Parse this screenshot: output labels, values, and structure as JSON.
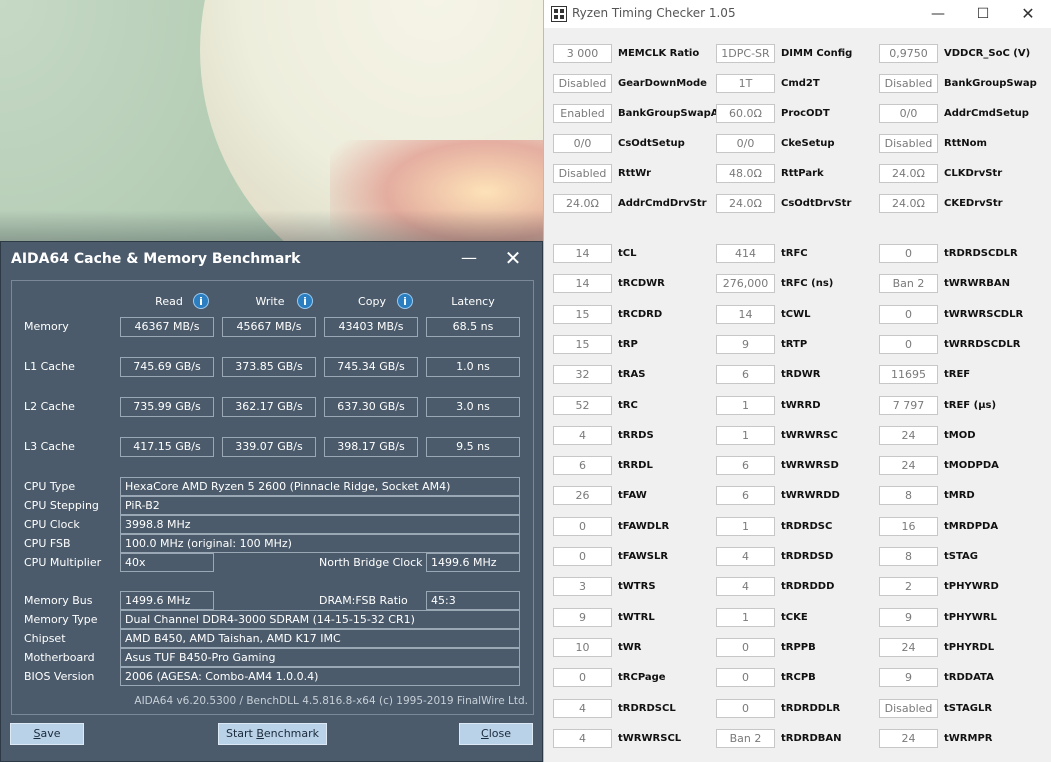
{
  "aida": {
    "title": "AIDA64 Cache & Memory Benchmark",
    "min_glyph": "—",
    "close_glyph": "✕",
    "headers": {
      "read": "Read",
      "write": "Write",
      "copy": "Copy",
      "latency": "Latency"
    },
    "info_glyph": "i",
    "bench_rows": [
      {
        "label": "Memory",
        "read": "46367 MB/s",
        "write": "45667 MB/s",
        "copy": "43403 MB/s",
        "latency": "68.5 ns"
      },
      {
        "label": "L1 Cache",
        "read": "745.69 GB/s",
        "write": "373.85 GB/s",
        "copy": "745.34 GB/s",
        "latency": "1.0 ns"
      },
      {
        "label": "L2 Cache",
        "read": "735.99 GB/s",
        "write": "362.17 GB/s",
        "copy": "637.30 GB/s",
        "latency": "3.0 ns"
      },
      {
        "label": "L3 Cache",
        "read": "417.15 GB/s",
        "write": "339.07 GB/s",
        "copy": "398.17 GB/s",
        "latency": "9.5 ns"
      }
    ],
    "info": {
      "cpu_type_label": "CPU Type",
      "cpu_type": "HexaCore AMD Ryzen 5 2600  (Pinnacle Ridge, Socket AM4)",
      "cpu_stepping_label": "CPU Stepping",
      "cpu_stepping": "PiR-B2",
      "cpu_clock_label": "CPU Clock",
      "cpu_clock": "3998.8 MHz",
      "cpu_fsb_label": "CPU FSB",
      "cpu_fsb": "100.0 MHz  (original: 100 MHz)",
      "cpu_mult_label": "CPU Multiplier",
      "cpu_mult": "40x",
      "nb_clock_label": "North Bridge Clock",
      "nb_clock": "1499.6 MHz",
      "mem_bus_label": "Memory Bus",
      "mem_bus": "1499.6 MHz",
      "dram_ratio_label": "DRAM:FSB Ratio",
      "dram_ratio": "45:3",
      "mem_type_label": "Memory Type",
      "mem_type": "Dual Channel DDR4-3000 SDRAM  (14-15-15-32 CR1)",
      "chipset_label": "Chipset",
      "chipset": "AMD B450, AMD Taishan, AMD K17 IMC",
      "mobo_label": "Motherboard",
      "mobo": "Asus TUF B450-Pro Gaming",
      "bios_label": "BIOS Version",
      "bios": "2006  (AGESA: Combo-AM4 1.0.0.4)"
    },
    "footer": "AIDA64 v6.20.5300 / BenchDLL 4.5.816.8-x64  (c) 1995-2019 FinalWire Ltd.",
    "buttons": {
      "save": "Save",
      "start": "Start Benchmark",
      "close": "Close"
    }
  },
  "rtc": {
    "title": "Ryzen Timing Checker 1.05",
    "min_glyph": "—",
    "max_glyph": "☐",
    "close_glyph": "✕",
    "top_rows": [
      [
        [
          "3 000",
          "MEMCLK Ratio"
        ],
        [
          "1DPC-SR",
          "DIMM Config"
        ],
        [
          "0,9750",
          "VDDCR_SoC (V)"
        ]
      ],
      [
        [
          "Disabled",
          "GearDownMode"
        ],
        [
          "1T",
          "Cmd2T"
        ],
        [
          "Disabled",
          "BankGroupSwap"
        ]
      ],
      [
        [
          "Enabled",
          "BankGroupSwapAlt"
        ],
        [
          "60.0Ω",
          "ProcODT"
        ],
        [
          "0/0",
          "AddrCmdSetup"
        ]
      ],
      [
        [
          "0/0",
          "CsOdtSetup"
        ],
        [
          "0/0",
          "CkeSetup"
        ],
        [
          "Disabled",
          "RttNom"
        ]
      ],
      [
        [
          "Disabled",
          "RttWr"
        ],
        [
          "48.0Ω",
          "RttPark"
        ],
        [
          "24.0Ω",
          "CLKDrvStr"
        ]
      ],
      [
        [
          "24.0Ω",
          "AddrCmdDrvStr"
        ],
        [
          "24.0Ω",
          "CsOdtDrvStr"
        ],
        [
          "24.0Ω",
          "CKEDrvStr"
        ]
      ]
    ],
    "timing_rows": [
      [
        [
          "14",
          "tCL"
        ],
        [
          "414",
          "tRFC"
        ],
        [
          "0",
          "tRDRDSCDLR"
        ]
      ],
      [
        [
          "14",
          "tRCDWR"
        ],
        [
          "276,000",
          "tRFC (ns)"
        ],
        [
          "Ban 2",
          "tWRWRBAN"
        ]
      ],
      [
        [
          "15",
          "tRCDRD"
        ],
        [
          "14",
          "tCWL"
        ],
        [
          "0",
          "tWRWRSCDLR"
        ]
      ],
      [
        [
          "15",
          "tRP"
        ],
        [
          "9",
          "tRTP"
        ],
        [
          "0",
          "tWRRDSCDLR"
        ]
      ],
      [
        [
          "32",
          "tRAS"
        ],
        [
          "6",
          "tRDWR"
        ],
        [
          "11695",
          "tREF"
        ]
      ],
      [
        [
          "52",
          "tRC"
        ],
        [
          "1",
          "tWRRD"
        ],
        [
          "7 797",
          "tREF (µs)"
        ]
      ],
      [
        [
          "4",
          "tRRDS"
        ],
        [
          "1",
          "tWRWRSC"
        ],
        [
          "24",
          "tMOD"
        ]
      ],
      [
        [
          "6",
          "tRRDL"
        ],
        [
          "6",
          "tWRWRSD"
        ],
        [
          "24",
          "tMODPDA"
        ]
      ],
      [
        [
          "26",
          "tFAW"
        ],
        [
          "6",
          "tWRWRDD"
        ],
        [
          "8",
          "tMRD"
        ]
      ],
      [
        [
          "0",
          "tFAWDLR"
        ],
        [
          "1",
          "tRDRDSC"
        ],
        [
          "16",
          "tMRDPDA"
        ]
      ],
      [
        [
          "0",
          "tFAWSLR"
        ],
        [
          "4",
          "tRDRDSD"
        ],
        [
          "8",
          "tSTAG"
        ]
      ],
      [
        [
          "3",
          "tWTRS"
        ],
        [
          "4",
          "tRDRDDD"
        ],
        [
          "2",
          "tPHYWRD"
        ]
      ],
      [
        [
          "9",
          "tWTRL"
        ],
        [
          "1",
          "tCKE"
        ],
        [
          "9",
          "tPHYWRL"
        ]
      ],
      [
        [
          "10",
          "tWR"
        ],
        [
          "0",
          "tRPPB"
        ],
        [
          "24",
          "tPHYRDL"
        ]
      ],
      [
        [
          "0",
          "tRCPage"
        ],
        [
          "0",
          "tRCPB"
        ],
        [
          "9",
          "tRDDATA"
        ]
      ],
      [
        [
          "4",
          "tRDRDSCL"
        ],
        [
          "0",
          "tRDRDDLR"
        ],
        [
          "Disabled",
          "tSTAGLR"
        ]
      ],
      [
        [
          "4",
          "tWRWRSCL"
        ],
        [
          "Ban 2",
          "tRDRDBAN"
        ],
        [
          "24",
          "tWRMPR"
        ]
      ]
    ]
  }
}
